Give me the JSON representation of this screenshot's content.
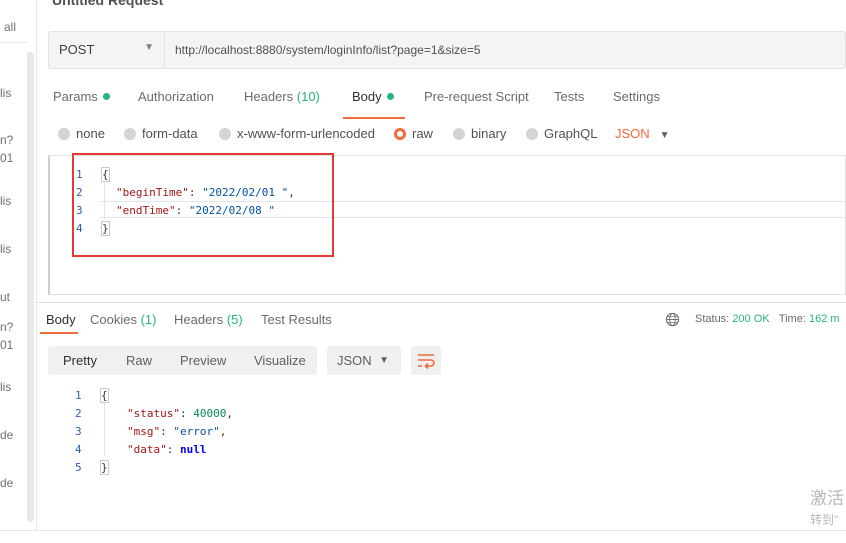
{
  "sidebar": {
    "snippets": [
      "all",
      "lis",
      "n?",
      "01",
      "lis",
      "lis",
      "ut",
      "n?",
      "01",
      "lis",
      "de",
      "de"
    ]
  },
  "request": {
    "title": "Untitled Request",
    "method": "POST",
    "url": "http://localhost:8880/system/loginInfo/list?page=1&size=5",
    "tabs": {
      "params": "Params",
      "authorization": "Authorization",
      "headers": "Headers",
      "headers_count": "(10)",
      "body": "Body",
      "prerequest": "Pre-request Script",
      "tests": "Tests",
      "settings": "Settings"
    },
    "body_types": {
      "none": "none",
      "form_data": "form-data",
      "urlencoded": "x-www-form-urlencoded",
      "raw": "raw",
      "binary": "binary",
      "graphql": "GraphQL",
      "format": "JSON"
    },
    "body_lines": {
      "ln1": "1",
      "ln2": "2",
      "ln3": "3",
      "ln4": "4",
      "open": "{",
      "k1": "\"beginTime\"",
      "v1": "\"2022/02/01 \"",
      "k2": "\"endTime\"",
      "v2": "\"2022/02/08 \"",
      "close": "}"
    }
  },
  "response": {
    "tabs": {
      "body": "Body",
      "cookies": "Cookies",
      "cookies_count": "(1)",
      "headers": "Headers",
      "headers_count": "(5)",
      "test_results": "Test Results"
    },
    "status_label": "Status:",
    "status_value": "200 OK",
    "time_label": "Time:",
    "time_value": "162 m",
    "views": {
      "pretty": "Pretty",
      "raw": "Raw",
      "preview": "Preview",
      "visualize": "Visualize"
    },
    "format": "JSON",
    "lines": {
      "ln1": "1",
      "ln2": "2",
      "ln3": "3",
      "ln4": "4",
      "ln5": "5",
      "open": "{",
      "k1": "\"status\"",
      "v1": "40000",
      "k2": "\"msg\"",
      "v2": "\"error\"",
      "k3": "\"data\"",
      "v3": "null",
      "close": "}"
    }
  },
  "watermark": {
    "line1": "激活",
    "line2": "转到\""
  },
  "colors": {
    "accent": "#f26b3a",
    "success": "#26b47f",
    "highlight_box": "#e53935"
  }
}
